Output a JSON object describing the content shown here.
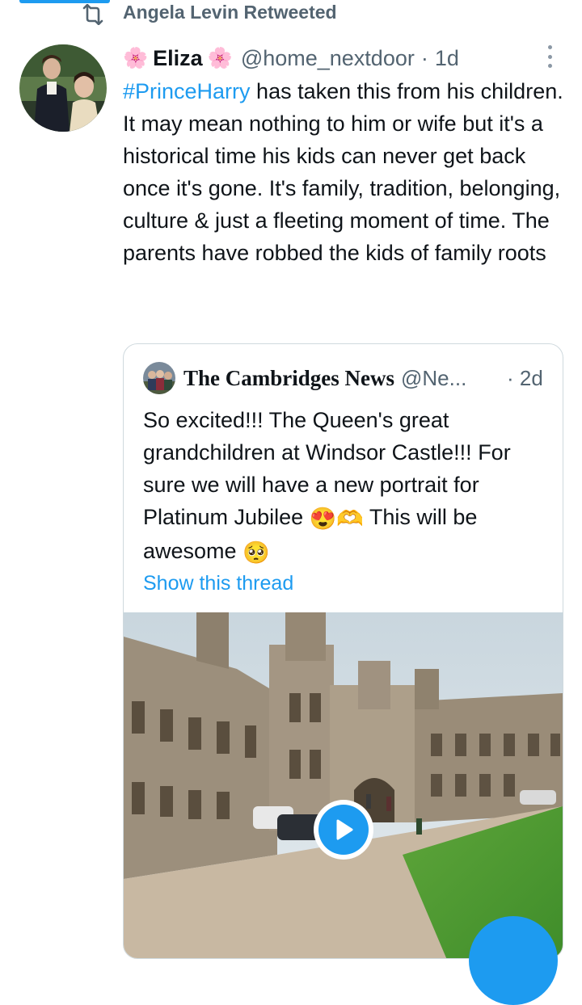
{
  "retweet": {
    "label": "Angela Levin Retweeted"
  },
  "tweet": {
    "flower_left": "🌸",
    "name": "Eliza",
    "flower_right": "🌸",
    "handle": "@home_nextdoor",
    "separator": "·",
    "time": "1d",
    "hashtag": "#PrinceHarry",
    "text": " has taken this from his children. It may mean nothing to him or wife but it's a historical time his kids can never get back once it's gone. It's family, tradition, belonging, culture & just a fleeting moment of time. The parents have robbed the kids of family roots"
  },
  "quote": {
    "name": "The Cambridges News",
    "handle": "@Ne...",
    "time": "· 2d",
    "text_part1": "So excited!!! The Queen's great grandchildren at Windsor Castle!!! For sure we will have a new portrait for Platinum Jubilee ",
    "emoji1": "😍",
    "emoji2": "🫶",
    "text_part2": " This will be awesome ",
    "emoji3": "🥺",
    "thread_link": "Show this thread"
  },
  "icons": {
    "retweet": "retweet-icon",
    "more": "more-options-icon",
    "play": "play-icon",
    "compose": "compose-icon"
  },
  "colors": {
    "accent": "#1d9bf0",
    "muted": "#536471",
    "text": "#0f1419",
    "border": "#cfd9de"
  }
}
